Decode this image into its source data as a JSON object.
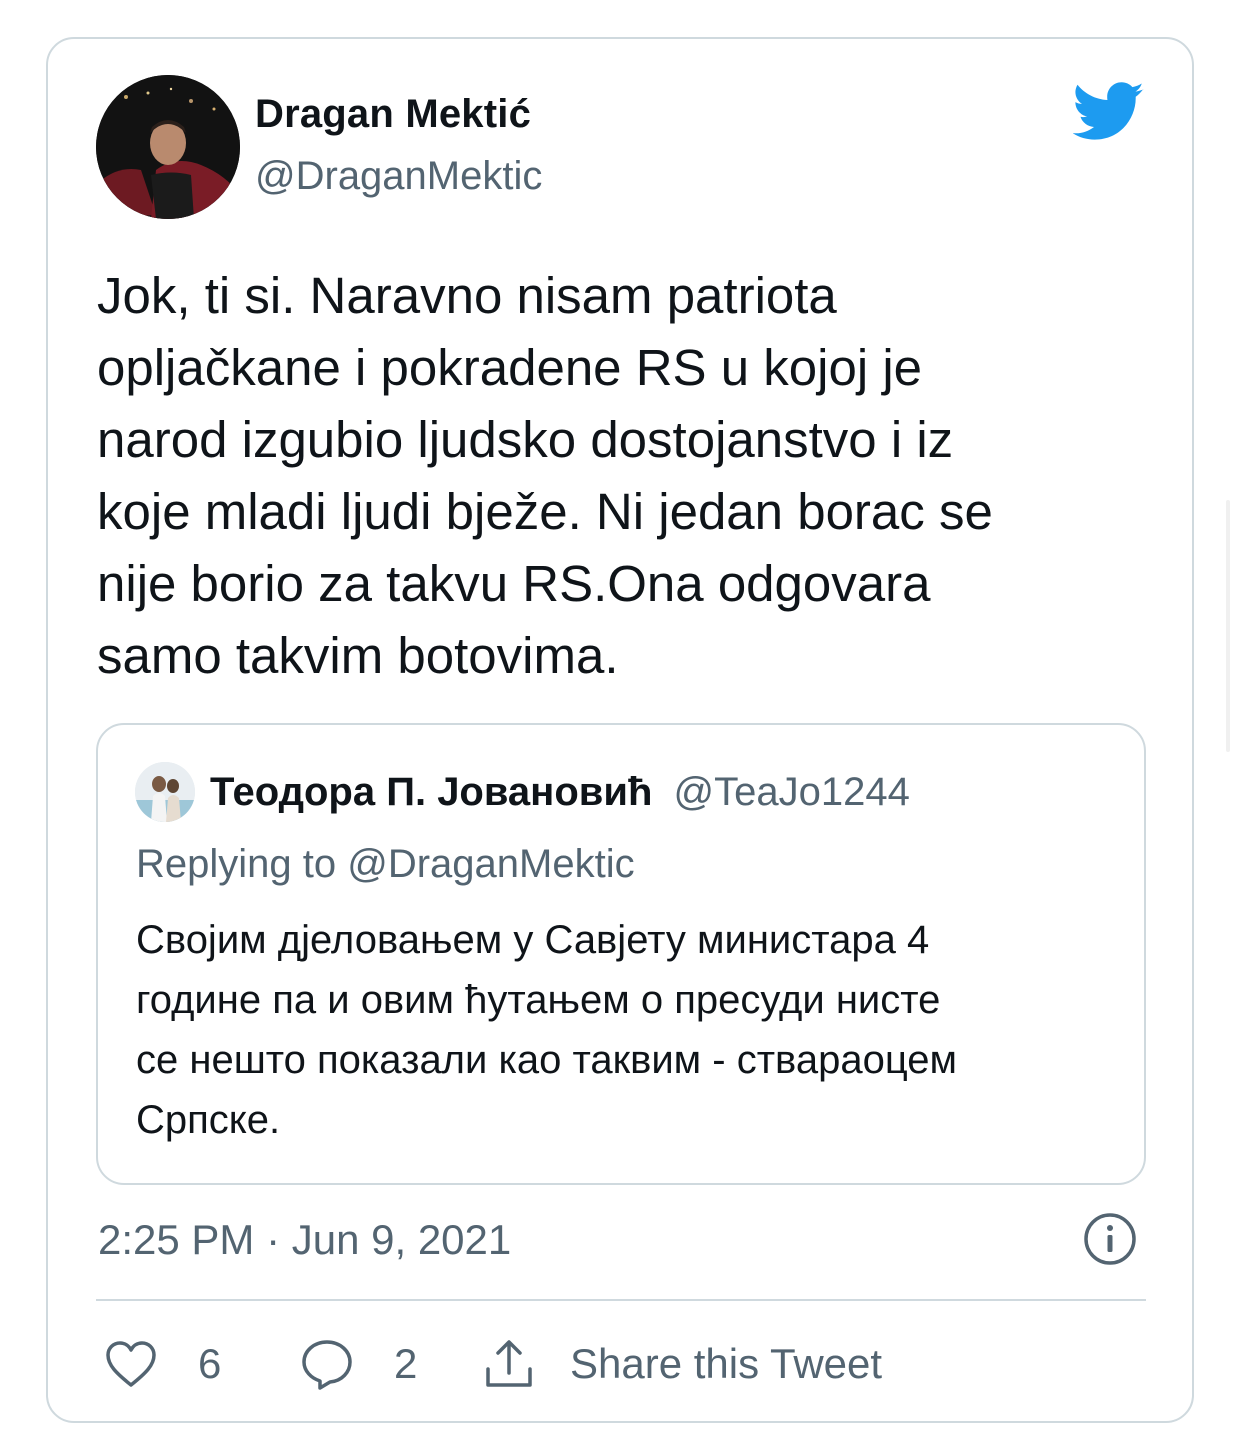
{
  "author": {
    "name": "Dragan Mektić",
    "handle": "@DraganMektic"
  },
  "tweet": {
    "lines": [
      "Jok, ti si. Naravno nisam patriota",
      "opljačkane i pokradene RS u kojoj je",
      "narod izgubio ljudsko dostojanstvo i iz",
      "koje mladi ljudi bježe. Ni jedan borac se",
      "nije borio za takvu RS.Ona odgovara",
      "samo takvim botovima."
    ]
  },
  "quoted": {
    "name": "Теодора П. Јовановић",
    "handle": "@TeaJo1244",
    "replying_prefix": "Replying to ",
    "replying_to": "@DraganMektic",
    "lines": [
      "Својим дјеловањем у Савјету министара 4",
      "године па и овим ћутањем о пресуди нисте",
      "се нешто показали као таквим - ствараоцем",
      "Српске."
    ]
  },
  "timestamp": "2:25 PM · Jun 9, 2021",
  "actions": {
    "likes": "6",
    "replies": "2",
    "share_label": "Share this Tweet"
  },
  "colors": {
    "twitter_blue": "#1d9bf0",
    "secondary_text": "#536471",
    "border": "#cfd9de"
  },
  "icons": [
    "twitter-bird-icon",
    "info-icon",
    "heart-icon",
    "reply-bubble-icon",
    "share-icon"
  ]
}
